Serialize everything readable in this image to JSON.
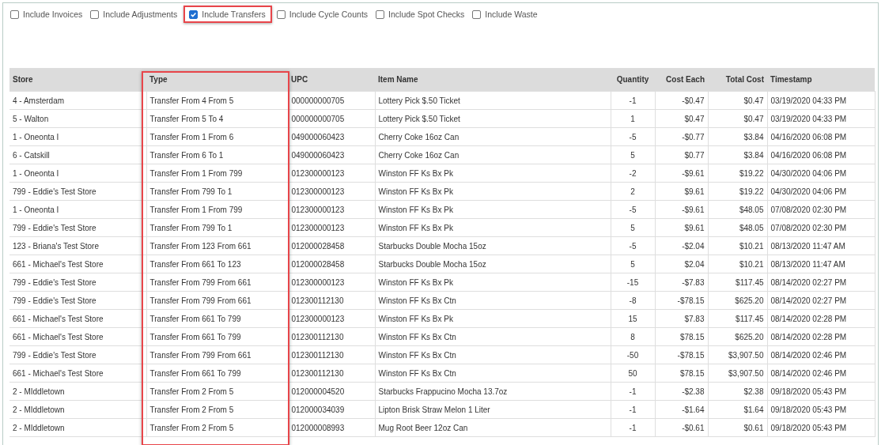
{
  "filters": [
    {
      "label": "Include Invoices",
      "checked": false,
      "highlighted": false
    },
    {
      "label": "Include Adjustments",
      "checked": false,
      "highlighted": false
    },
    {
      "label": "Include Transfers",
      "checked": true,
      "highlighted": true
    },
    {
      "label": "Include Cycle Counts",
      "checked": false,
      "highlighted": false
    },
    {
      "label": "Include Spot Checks",
      "checked": false,
      "highlighted": false
    },
    {
      "label": "Include Waste",
      "checked": false,
      "highlighted": false
    }
  ],
  "table": {
    "columns": [
      {
        "label": "Store",
        "highlighted": false
      },
      {
        "label": "Type",
        "highlighted": true
      },
      {
        "label": "UPC",
        "highlighted": false
      },
      {
        "label": "Item Name",
        "highlighted": false
      },
      {
        "label": "Quantity",
        "highlighted": false
      },
      {
        "label": "Cost Each",
        "highlighted": false
      },
      {
        "label": "Total Cost",
        "highlighted": false
      },
      {
        "label": "Timestamp",
        "highlighted": false
      }
    ],
    "rows": [
      [
        "4 - Amsterdam",
        "Transfer From 4 From 5",
        "000000000705",
        "Lottery Pick $.50 Ticket",
        "-1",
        "-$0.47",
        "$0.47",
        "03/19/2020 04:33 PM"
      ],
      [
        "5 - Walton",
        "Transfer From 5 To 4",
        "000000000705",
        "Lottery Pick $.50 Ticket",
        "1",
        "$0.47",
        "$0.47",
        "03/19/2020 04:33 PM"
      ],
      [
        "1 - Oneonta I",
        "Transfer From 1 From 6",
        "049000060423",
        "Cherry Coke 16oz Can",
        "-5",
        "-$0.77",
        "$3.84",
        "04/16/2020 06:08 PM"
      ],
      [
        "6 - Catskill",
        "Transfer From 6 To 1",
        "049000060423",
        "Cherry Coke 16oz Can",
        "5",
        "$0.77",
        "$3.84",
        "04/16/2020 06:08 PM"
      ],
      [
        "1 - Oneonta I",
        "Transfer From 1 From 799",
        "012300000123",
        "Winston FF Ks Bx Pk",
        "-2",
        "-$9.61",
        "$19.22",
        "04/30/2020 04:06 PM"
      ],
      [
        "799 - Eddie's Test Store",
        "Transfer From 799 To 1",
        "012300000123",
        "Winston FF Ks Bx Pk",
        "2",
        "$9.61",
        "$19.22",
        "04/30/2020 04:06 PM"
      ],
      [
        "1 - Oneonta I",
        "Transfer From 1 From 799",
        "012300000123",
        "Winston FF Ks Bx Pk",
        "-5",
        "-$9.61",
        "$48.05",
        "07/08/2020 02:30 PM"
      ],
      [
        "799 - Eddie's Test Store",
        "Transfer From 799 To 1",
        "012300000123",
        "Winston FF Ks Bx Pk",
        "5",
        "$9.61",
        "$48.05",
        "07/08/2020 02:30 PM"
      ],
      [
        "123 - Briana's Test Store",
        "Transfer From 123 From 661",
        "012000028458",
        "Starbucks Double Mocha 15oz",
        "-5",
        "-$2.04",
        "$10.21",
        "08/13/2020 11:47 AM"
      ],
      [
        "661 - Michael's Test Store",
        "Transfer From 661 To 123",
        "012000028458",
        "Starbucks Double Mocha 15oz",
        "5",
        "$2.04",
        "$10.21",
        "08/13/2020 11:47 AM"
      ],
      [
        "799 - Eddie's Test Store",
        "Transfer From 799 From 661",
        "012300000123",
        "Winston FF Ks Bx Pk",
        "-15",
        "-$7.83",
        "$117.45",
        "08/14/2020 02:27 PM"
      ],
      [
        "799 - Eddie's Test Store",
        "Transfer From 799 From 661",
        "012300112130",
        "Winston FF Ks Bx Ctn",
        "-8",
        "-$78.15",
        "$625.20",
        "08/14/2020 02:27 PM"
      ],
      [
        "661 - Michael's Test Store",
        "Transfer From 661 To 799",
        "012300000123",
        "Winston FF Ks Bx Pk",
        "15",
        "$7.83",
        "$117.45",
        "08/14/2020 02:28 PM"
      ],
      [
        "661 - Michael's Test Store",
        "Transfer From 661 To 799",
        "012300112130",
        "Winston FF Ks Bx Ctn",
        "8",
        "$78.15",
        "$625.20",
        "08/14/2020 02:28 PM"
      ],
      [
        "799 - Eddie's Test Store",
        "Transfer From 799 From 661",
        "012300112130",
        "Winston FF Ks Bx Ctn",
        "-50",
        "-$78.15",
        "$3,907.50",
        "08/14/2020 02:46 PM"
      ],
      [
        "661 - Michael's Test Store",
        "Transfer From 661 To 799",
        "012300112130",
        "Winston FF Ks Bx Ctn",
        "50",
        "$78.15",
        "$3,907.50",
        "08/14/2020 02:46 PM"
      ],
      [
        "2 - MIddletown",
        "Transfer From 2 From 5",
        "012000004520",
        "Starbucks Frappucino Mocha 13.7oz",
        "-1",
        "-$2.38",
        "$2.38",
        "09/18/2020 05:43 PM"
      ],
      [
        "2 - MIddletown",
        "Transfer From 2 From 5",
        "012000034039",
        "Lipton Brisk Straw Melon 1 Liter",
        "-1",
        "-$1.64",
        "$1.64",
        "09/18/2020 05:43 PM"
      ],
      [
        "2 - MIddletown",
        "Transfer From 2 From 5",
        "012000008993",
        "Mug Root Beer 12oz Can",
        "-1",
        "-$0.61",
        "$0.61",
        "09/18/2020 05:43 PM"
      ]
    ]
  }
}
